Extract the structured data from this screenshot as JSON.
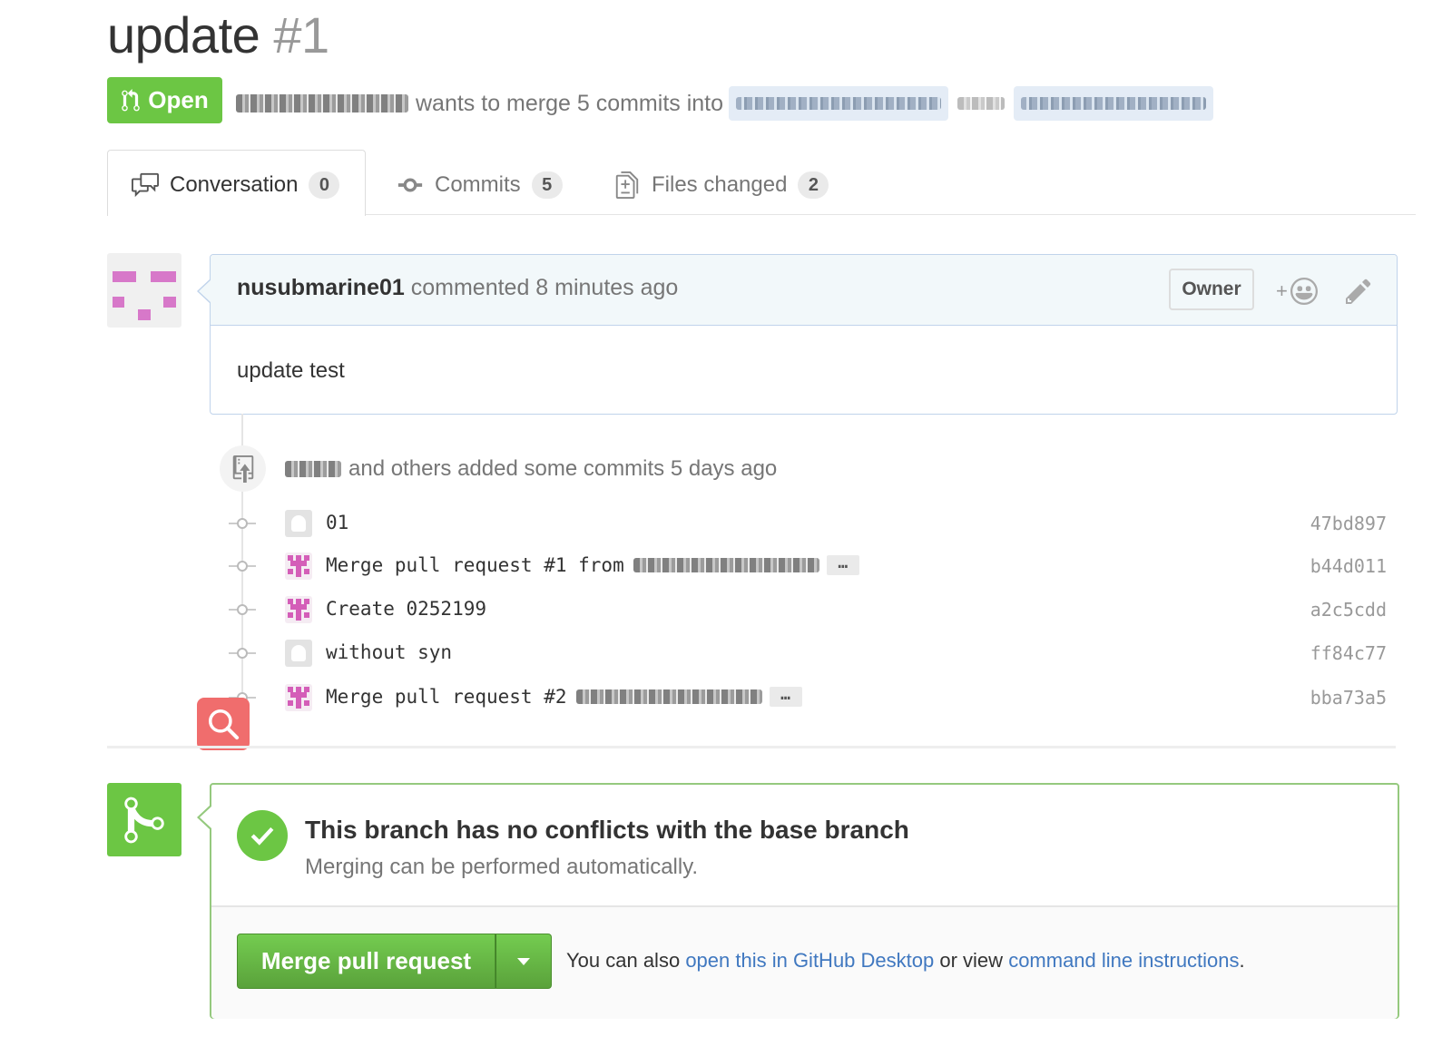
{
  "pr": {
    "title": "update",
    "number": "#1",
    "state": "Open",
    "merge_text": "wants to merge 5 commits into"
  },
  "tabs": [
    {
      "label": "Conversation",
      "count": "0",
      "icon": "comment-discussion-icon"
    },
    {
      "label": "Commits",
      "count": "5",
      "icon": "git-commit-icon"
    },
    {
      "label": "Files changed",
      "count": "2",
      "icon": "file-diff-icon"
    }
  ],
  "comment": {
    "author": "nusubmarine01",
    "action": "commented 8 minutes ago",
    "role": "Owner",
    "reaction": "+",
    "body": "update test"
  },
  "timeline": {
    "summary": "and others added some commits 5 days ago"
  },
  "commits": [
    {
      "message": "01",
      "sha": "47bd897",
      "avatar": "gray",
      "truncated": false
    },
    {
      "message": "Merge pull request #1 from",
      "sha": "b44d011",
      "avatar": "pink",
      "truncated": true
    },
    {
      "message": "Create 0252199",
      "sha": "a2c5cdd",
      "avatar": "pink",
      "truncated": false
    },
    {
      "message": "without syn",
      "sha": "ff84c77",
      "avatar": "gray",
      "truncated": false
    },
    {
      "message": "Merge pull request #2",
      "sha": "bba73a5",
      "avatar": "pink",
      "truncated": true
    }
  ],
  "merge": {
    "heading": "This branch has no conflicts with the base branch",
    "subtext": "Merging can be performed automatically.",
    "button": "Merge pull request",
    "note_prefix": "You can also",
    "link_desktop": "open this in GitHub Desktop",
    "note_middle": "or view",
    "link_cli": "command line instructions",
    "note_suffix": "."
  },
  "colors": {
    "open_green": "#6cc644",
    "link_blue": "#4078c0",
    "search_red": "#f06d6d"
  }
}
